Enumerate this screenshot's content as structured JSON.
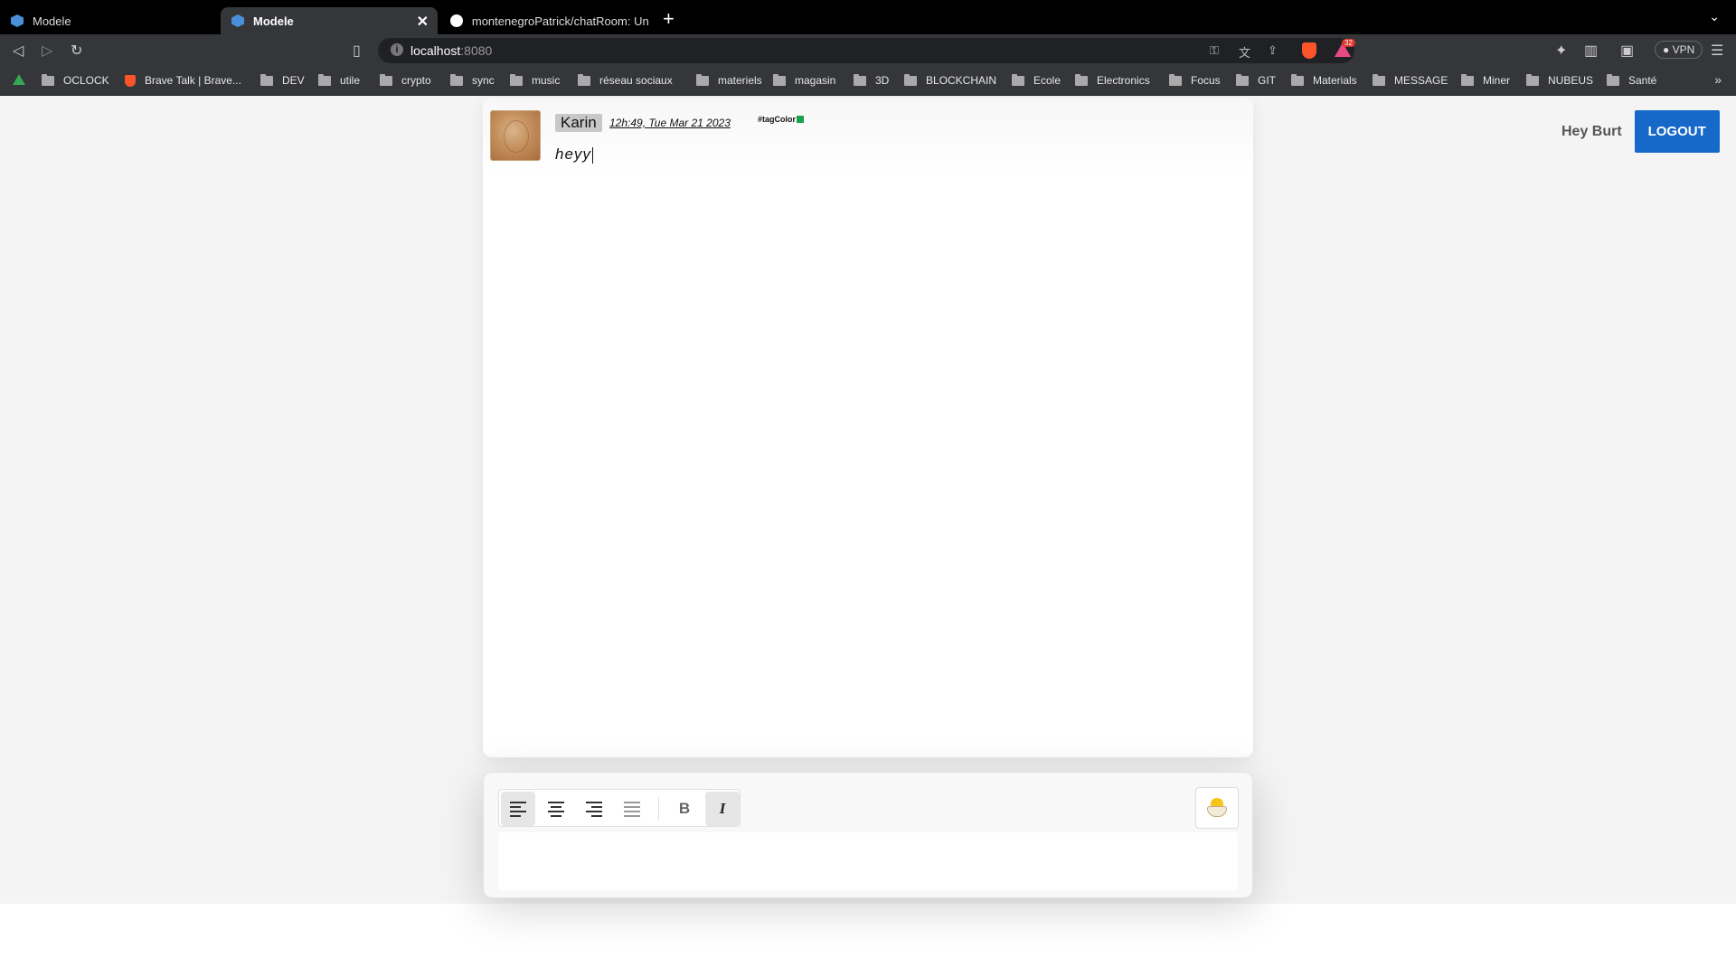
{
  "tabs": [
    {
      "title": "Modele",
      "active": false
    },
    {
      "title": "Modele",
      "active": true
    },
    {
      "title": "montenegroPatrick/chatRoom: Un e",
      "active": false
    }
  ],
  "address": {
    "host": "localhost",
    "port": ":8080"
  },
  "extensions": {
    "rewards_count": "32",
    "vpn_label": "VPN"
  },
  "bookmarks": [
    "OCLOCK",
    "Brave Talk | Brave...",
    "DEV",
    "utile",
    "crypto",
    "sync",
    "music",
    "réseau sociaux",
    "materiels",
    "magasin",
    "3D",
    "BLOCKCHAIN",
    "Ecole",
    "Electronics",
    "Focus",
    "GIT",
    "Materials",
    "MESSAGE",
    "Miner",
    "NUBEUS",
    "Santé"
  ],
  "header": {
    "greeting": "Hey Burt",
    "logout_label": "LOGOUT"
  },
  "messages": [
    {
      "author": "Karin",
      "time": "12h:49, Tue Mar 21 2023",
      "tag": "#tagColor",
      "tag_color": "#16a34a",
      "text": "heyy"
    }
  ],
  "composer": {
    "buttons": [
      {
        "name": "align-left",
        "active": true
      },
      {
        "name": "align-center",
        "active": false
      },
      {
        "name": "align-right",
        "active": false
      },
      {
        "name": "align-justify",
        "active": false
      },
      {
        "name": "bold",
        "label": "B",
        "active": false
      },
      {
        "name": "italic",
        "label": "I",
        "active": true
      }
    ],
    "emoji_icon": "hatching-chick-icon"
  },
  "colors": {
    "accent": "#1668c9",
    "tag": "#16a34a"
  }
}
